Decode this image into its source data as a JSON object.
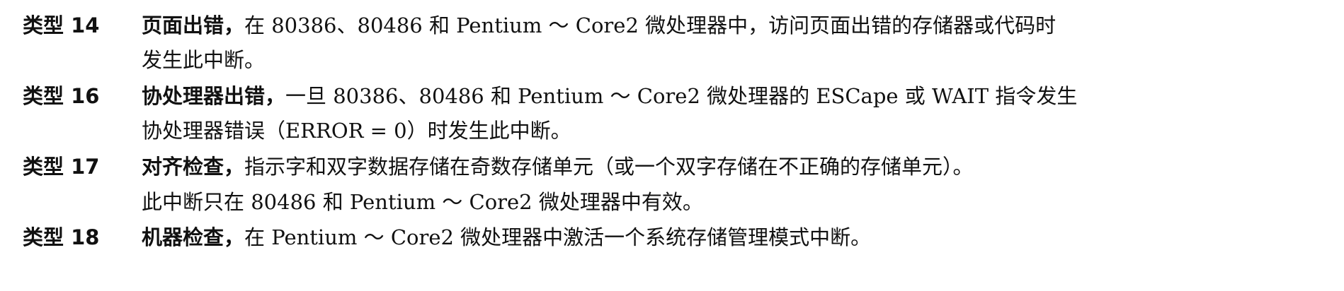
{
  "entries": [
    {
      "label": "类型 14",
      "term": "页面出错，",
      "line1": "在 80386、80486 和 Pentium ～ Core2 微处理器中，访问页面出错的存储器或代码时",
      "line2": "发生此中断。"
    },
    {
      "label": "类型 16",
      "term": "协处理器出错，",
      "line1": "一旦 80386、80486 和 Pentium ～ Core2 微处理器的 ESCape 或 WAIT 指令发生",
      "line2": "协处理器错误（ERROR = 0）时发生此中断。"
    },
    {
      "label": "类型 17",
      "term": "对齐检查，",
      "line1": "指示字和双字数据存储在奇数存储单元（或一个双字存储在不正确的存储单元）。",
      "line2": "此中断只在 80486 和 Pentium ～ Core2 微处理器中有效。"
    },
    {
      "label": "类型 18",
      "term": "机器检查，",
      "line1": "在 Pentium ～ Core2 微处理器中激活一个系统存储管理模式中断。"
    }
  ]
}
